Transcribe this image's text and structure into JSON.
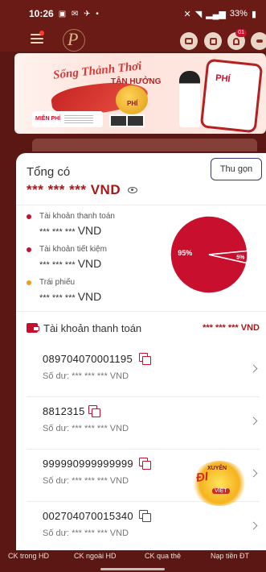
{
  "status_bar": {
    "time": "10:26",
    "battery": "33%"
  },
  "header": {
    "notification_count": "01",
    "logo_glyph": "P"
  },
  "banner": {
    "headline": "Sống Thảnh Thơi",
    "subheadline": "TẬN HƯỞNG",
    "free_label": "MIỄN PHÍ",
    "coin_label": "PHÍ",
    "phone_brand": "PHÍ"
  },
  "summary": {
    "title": "Tổng có",
    "collapse_label": "Thu gọn",
    "total_value": "*** *** *** VND"
  },
  "accounts": [
    {
      "label": "Tài khoản thanh toán",
      "value_mask": "*** *** ***",
      "currency": "VND",
      "color": "#c8102e"
    },
    {
      "label": "Tài khoản tiết kiệm",
      "value_mask": "*** *** ***",
      "currency": "VND",
      "color": "#c8102e"
    },
    {
      "label": "Trái phiếu",
      "value_mask": "*** *** ***",
      "currency": "VND",
      "color": "#f29a1f"
    }
  ],
  "chart_data": {
    "type": "pie",
    "slices": [
      {
        "name": "Tài khoản thanh toán",
        "value": 95,
        "label": "95%",
        "color": "#c8102e"
      },
      {
        "name": "Tài khoản tiết kiệm",
        "value": 5,
        "label": "5%",
        "color": "#c8102e"
      }
    ]
  },
  "payment_section": {
    "title": "Tài khoản thanh toán",
    "value": "*** *** *** VND"
  },
  "account_list": [
    {
      "number": "089704070001195",
      "balance": "Số dư: *** *** *** VND"
    },
    {
      "number": "8812315",
      "balance": "Số dư: *** *** *** VND"
    },
    {
      "number": "999990999999999",
      "balance": "Số dư: *** *** *** VND"
    },
    {
      "number": "002704070015340",
      "balance": "Số dư: *** *** *** VND"
    }
  ],
  "promo": {
    "top_text": "XUYÊN",
    "main_text": "ĐI",
    "badge_text": "VIỆT"
  },
  "bottom_actions": [
    {
      "label": "CK trong HD"
    },
    {
      "label": "CK ngoài HD"
    },
    {
      "label": "CK qua thẻ"
    },
    {
      "label": "Nạp tiền ĐT"
    }
  ]
}
